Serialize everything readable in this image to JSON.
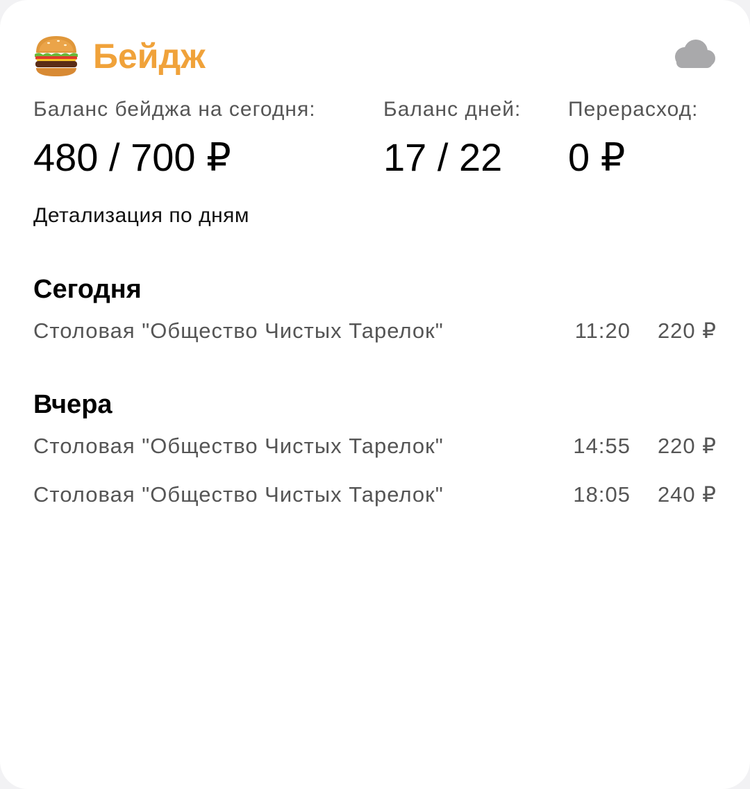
{
  "app": {
    "title": "Бейдж",
    "icon": "burger-icon",
    "sync_icon": "cloud-icon",
    "accent_color": "#f0a23a"
  },
  "stats": {
    "badge_balance_label": "Баланс бейджа на сегодня:",
    "badge_balance_value": "480 / 700 ₽",
    "days_balance_label": "Баланс дней:",
    "days_balance_value": "17 / 22",
    "overspend_label": "Перерасход:",
    "overspend_value": "0 ₽"
  },
  "details_link": "Детализация по дням",
  "days": [
    {
      "title": "Сегодня",
      "transactions": [
        {
          "place": "Столовая \"Общество Чистых Тарелок\"",
          "time": "11:20",
          "amount": "220 ₽"
        }
      ]
    },
    {
      "title": "Вчера",
      "transactions": [
        {
          "place": "Столовая \"Общество Чистых Тарелок\"",
          "time": "14:55",
          "amount": "220 ₽"
        },
        {
          "place": "Столовая \"Общество Чистых Тарелок\"",
          "time": "18:05",
          "amount": "240 ₽"
        }
      ]
    }
  ]
}
